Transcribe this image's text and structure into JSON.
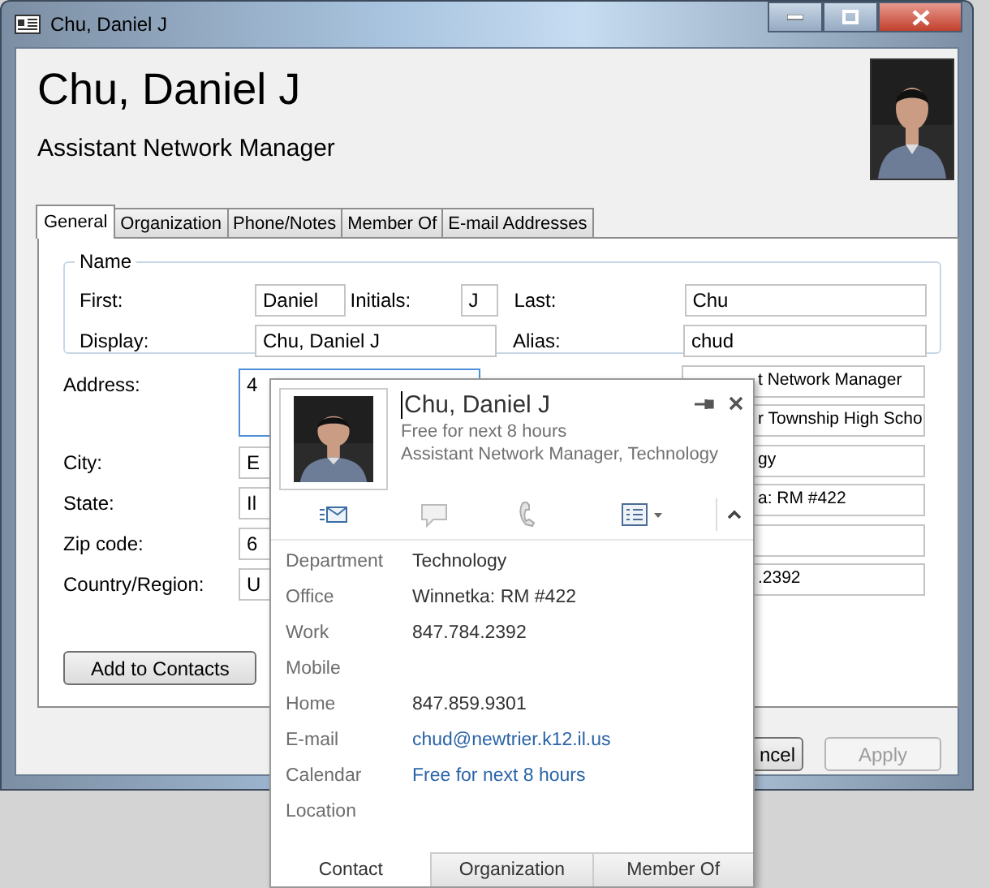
{
  "window": {
    "title": "Chu, Daniel J"
  },
  "header": {
    "name": "Chu, Daniel J",
    "job_title": "Assistant Network Manager"
  },
  "tabs": [
    {
      "label": "General",
      "selected": true
    },
    {
      "label": "Organization",
      "selected": false
    },
    {
      "label": "Phone/Notes",
      "selected": false
    },
    {
      "label": "Member Of",
      "selected": false
    },
    {
      "label": "E-mail Addresses",
      "selected": false
    }
  ],
  "name_group": {
    "legend": "Name",
    "first_label": "First:",
    "first": "Daniel",
    "initials_label": "Initials:",
    "initials": "J",
    "last_label": "Last:",
    "last": "Chu",
    "display_label": "Display:",
    "display": "Chu, Daniel J",
    "alias_label": "Alias:",
    "alias": "chud"
  },
  "address_fields": [
    {
      "label": "Address:",
      "value": "4",
      "focused": true
    },
    {
      "label": "City:",
      "value": "E",
      "focused": false
    },
    {
      "label": "State:",
      "value": "Il",
      "focused": false
    },
    {
      "label": "Zip code:",
      "value": "6",
      "focused": false
    },
    {
      "label": "Country/Region:",
      "value": "U",
      "focused": false
    }
  ],
  "right_fields": [
    {
      "kind": "text",
      "value": "t Network Manager"
    },
    {
      "kind": "text",
      "value": "r Township High Scho"
    },
    {
      "kind": "text",
      "value": "gy"
    },
    {
      "kind": "text",
      "value": "a: RM #422"
    },
    {
      "kind": "blank"
    },
    {
      "kind": "text",
      "value": ".2392"
    }
  ],
  "add_button": "Add to Contacts",
  "dialog_buttons": [
    {
      "label": "ncel",
      "disabled": false
    },
    {
      "label": "Apply",
      "disabled": true
    }
  ],
  "contact_card": {
    "name": "Chu, Daniel J",
    "availability": "Free for next 8 hours",
    "subtitle": "Assistant Network Manager, Technology",
    "details": [
      {
        "label": "Department",
        "value": "Technology",
        "kind": "text"
      },
      {
        "label": "Office",
        "value": "Winnetka: RM #422",
        "kind": "text"
      },
      {
        "label": "Work",
        "value": "847.784.2392",
        "kind": "text"
      },
      {
        "label": "Mobile"
      },
      {
        "label": "Home",
        "value": "847.859.9301",
        "kind": "text"
      },
      {
        "label": "E-mail",
        "value": "chud@newtrier.k12.il.us",
        "kind": "link"
      },
      {
        "label": "Calendar",
        "value": "Free for next 8 hours",
        "kind": "link"
      },
      {
        "label": "Location"
      }
    ],
    "tabs": [
      {
        "label": "Contact",
        "selected": true
      },
      {
        "label": "Organization",
        "selected": false
      },
      {
        "label": "Member Of",
        "selected": false
      }
    ]
  }
}
